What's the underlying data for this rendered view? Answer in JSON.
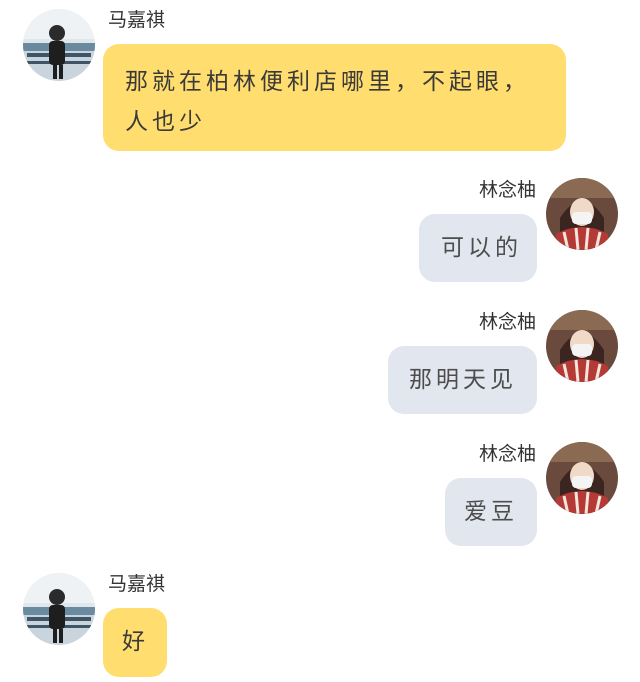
{
  "messages": [
    {
      "side": "left",
      "sender": "马嘉祺",
      "lines": [
        "那就在柏林便利店哪里，不起眼，",
        "人也少"
      ]
    },
    {
      "side": "right",
      "sender": "林念柚",
      "lines": [
        "可以的"
      ]
    },
    {
      "side": "right",
      "sender": "林念柚",
      "lines": [
        "那明天见"
      ]
    },
    {
      "side": "right",
      "sender": "林念柚",
      "lines": [
        "爱豆"
      ]
    },
    {
      "side": "left",
      "sender": "马嘉祺",
      "lines": [
        "好"
      ]
    }
  ],
  "colors": {
    "left_bubble": "#ffdd6e",
    "right_bubble": "#e2e6ee",
    "text": "#333333"
  }
}
